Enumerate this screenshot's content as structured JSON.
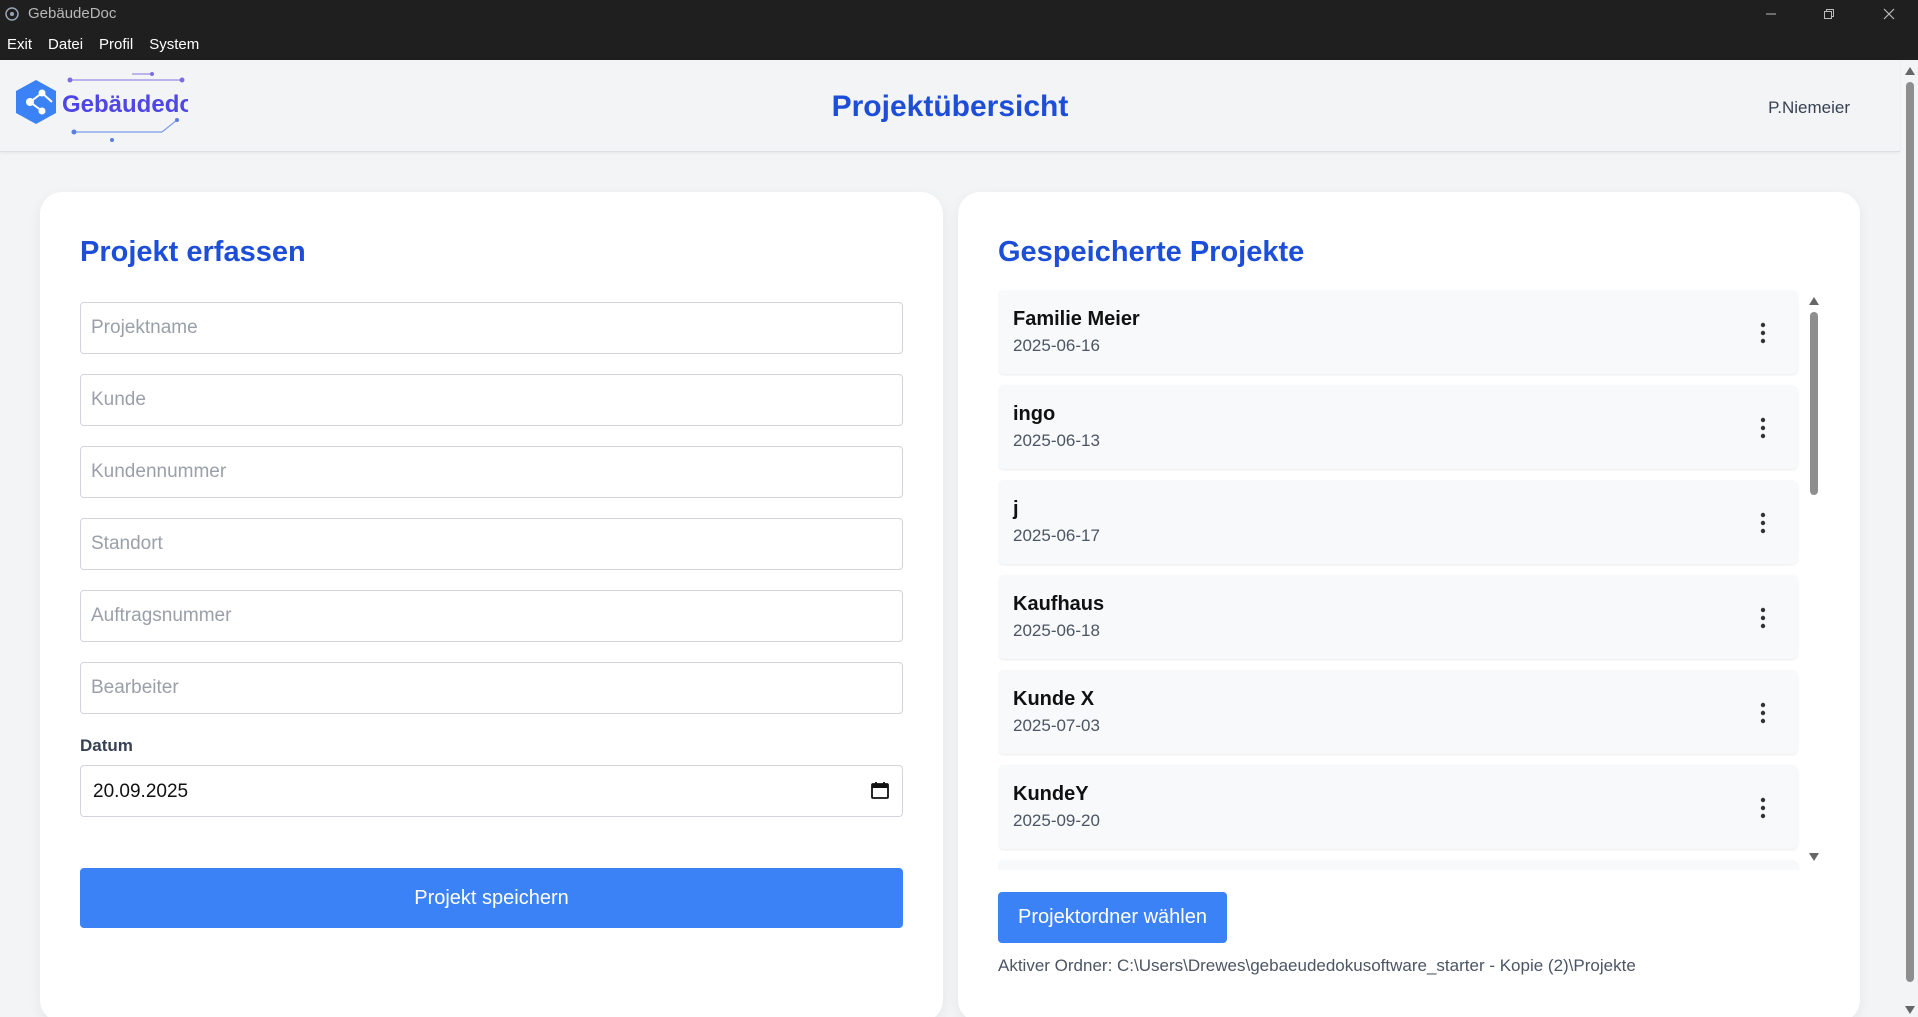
{
  "window": {
    "title": "GebäudeDoc",
    "minimize_icon": "minimize-icon",
    "maximize_icon": "restore-icon",
    "close_icon": "close-icon"
  },
  "menu": [
    "Exit",
    "Datei",
    "Profil",
    "System"
  ],
  "header": {
    "logo_text": "Gebäudedoc",
    "title": "Projektübersicht",
    "user": "P.Niemeier"
  },
  "form": {
    "title": "Projekt erfassen",
    "fields": {
      "projektname": "Projektname",
      "kunde": "Kunde",
      "kundennummer": "Kundennummer",
      "standort": "Standort",
      "auftragsnummer": "Auftragsnummer",
      "bearbeiter": "Bearbeiter"
    },
    "date_label": "Datum",
    "date_value": "20.09.2025",
    "save_label": "Projekt speichern"
  },
  "projects": {
    "title": "Gespeicherte Projekte",
    "items": [
      {
        "name": "Familie Meier",
        "date": "2025-06-16"
      },
      {
        "name": "ingo",
        "date": "2025-06-13"
      },
      {
        "name": "j",
        "date": "2025-06-17"
      },
      {
        "name": "Kaufhaus",
        "date": "2025-06-18"
      },
      {
        "name": "Kunde X",
        "date": "2025-07-03"
      },
      {
        "name": "KundeY",
        "date": "2025-09-20"
      }
    ],
    "folder_button": "Projektordner wählen",
    "active_folder": "Aktiver Ordner: C:\\Users\\Drewes\\gebaeudedokusoftware_starter - Kopie (2)\\Projekte"
  },
  "colors": {
    "accent": "#3b82f6",
    "title_blue": "#1d4ed8",
    "titlebar": "#1f1f1f"
  }
}
